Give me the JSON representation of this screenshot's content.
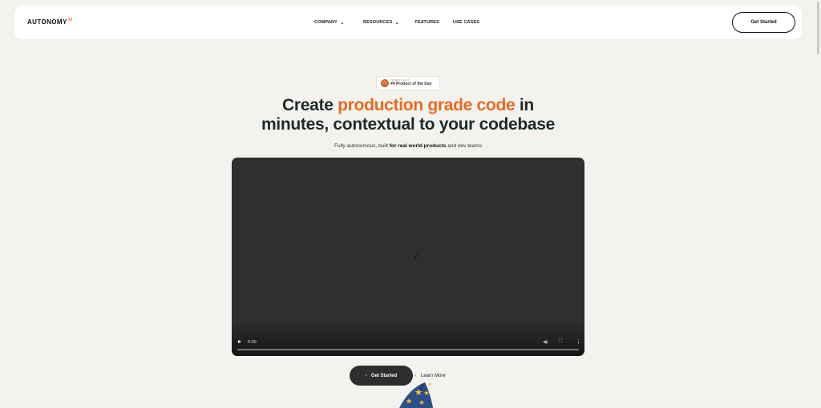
{
  "nav": {
    "logo": "AUTONOMY",
    "logo_sup": "AI",
    "menu": [
      {
        "label": "COMPANY",
        "dropdown": true
      },
      {
        "label": "RESOURCES",
        "dropdown": true
      },
      {
        "label": "FEATURES",
        "dropdown": false
      },
      {
        "label": "USE CASES",
        "dropdown": false
      }
    ],
    "cta": "Get Started"
  },
  "badge": {
    "small": "PRODUCT HUNT",
    "label": "#4 Product of the Day"
  },
  "hero": {
    "title_part1": "Create ",
    "title_accent": "production grade code",
    "title_part2": " in",
    "title_line2": "minutes, contextual to your codebase",
    "subtitle_pre": "Fully autonomous, built ",
    "subtitle_bold": "for real world  products",
    "subtitle_post": " and dev teams"
  },
  "video": {
    "time": "0:00"
  },
  "actions": {
    "primary": "Get Started",
    "secondary": "Learn More"
  },
  "colors": {
    "accent": "#ea6a1e",
    "background": "#f3f2ee",
    "heading": "#1d2b29",
    "video_bg": "#2f2f2f"
  },
  "icons": {
    "badge_icon": "medal-icon",
    "play": "play-icon",
    "mute": "volume-icon",
    "fullscreen": "fullscreen-icon",
    "more": "more-options-icon",
    "chevron": "chevron-right-icon",
    "mascot": "wizard-hat"
  }
}
